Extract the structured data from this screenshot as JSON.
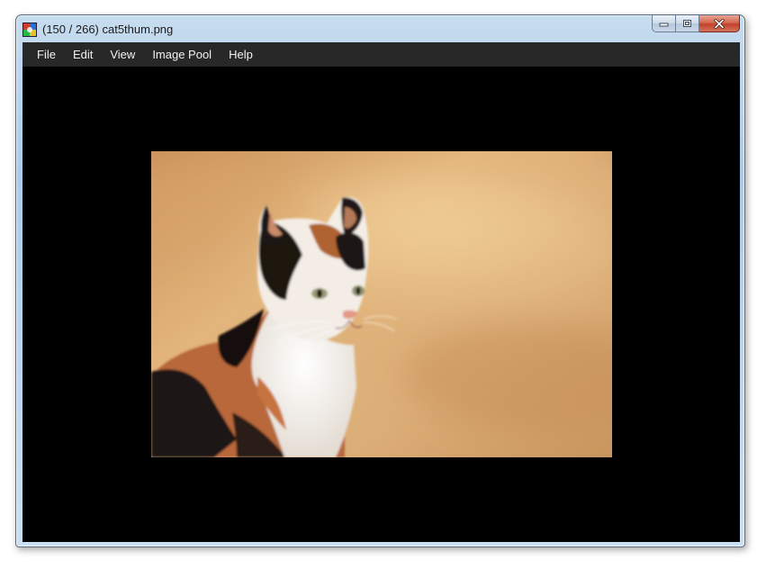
{
  "window": {
    "title": "(150 / 266) cat5thum.png"
  },
  "menu": {
    "items": [
      {
        "label": "File"
      },
      {
        "label": "Edit"
      },
      {
        "label": "View"
      },
      {
        "label": "Image Pool"
      },
      {
        "label": "Help"
      }
    ]
  },
  "image": {
    "subject": "calico cat",
    "background_color": "#000000"
  },
  "icons": {
    "app": "app-icon",
    "minimize": "minimize-icon",
    "maximize": "maximize-icon",
    "close": "close-icon"
  }
}
